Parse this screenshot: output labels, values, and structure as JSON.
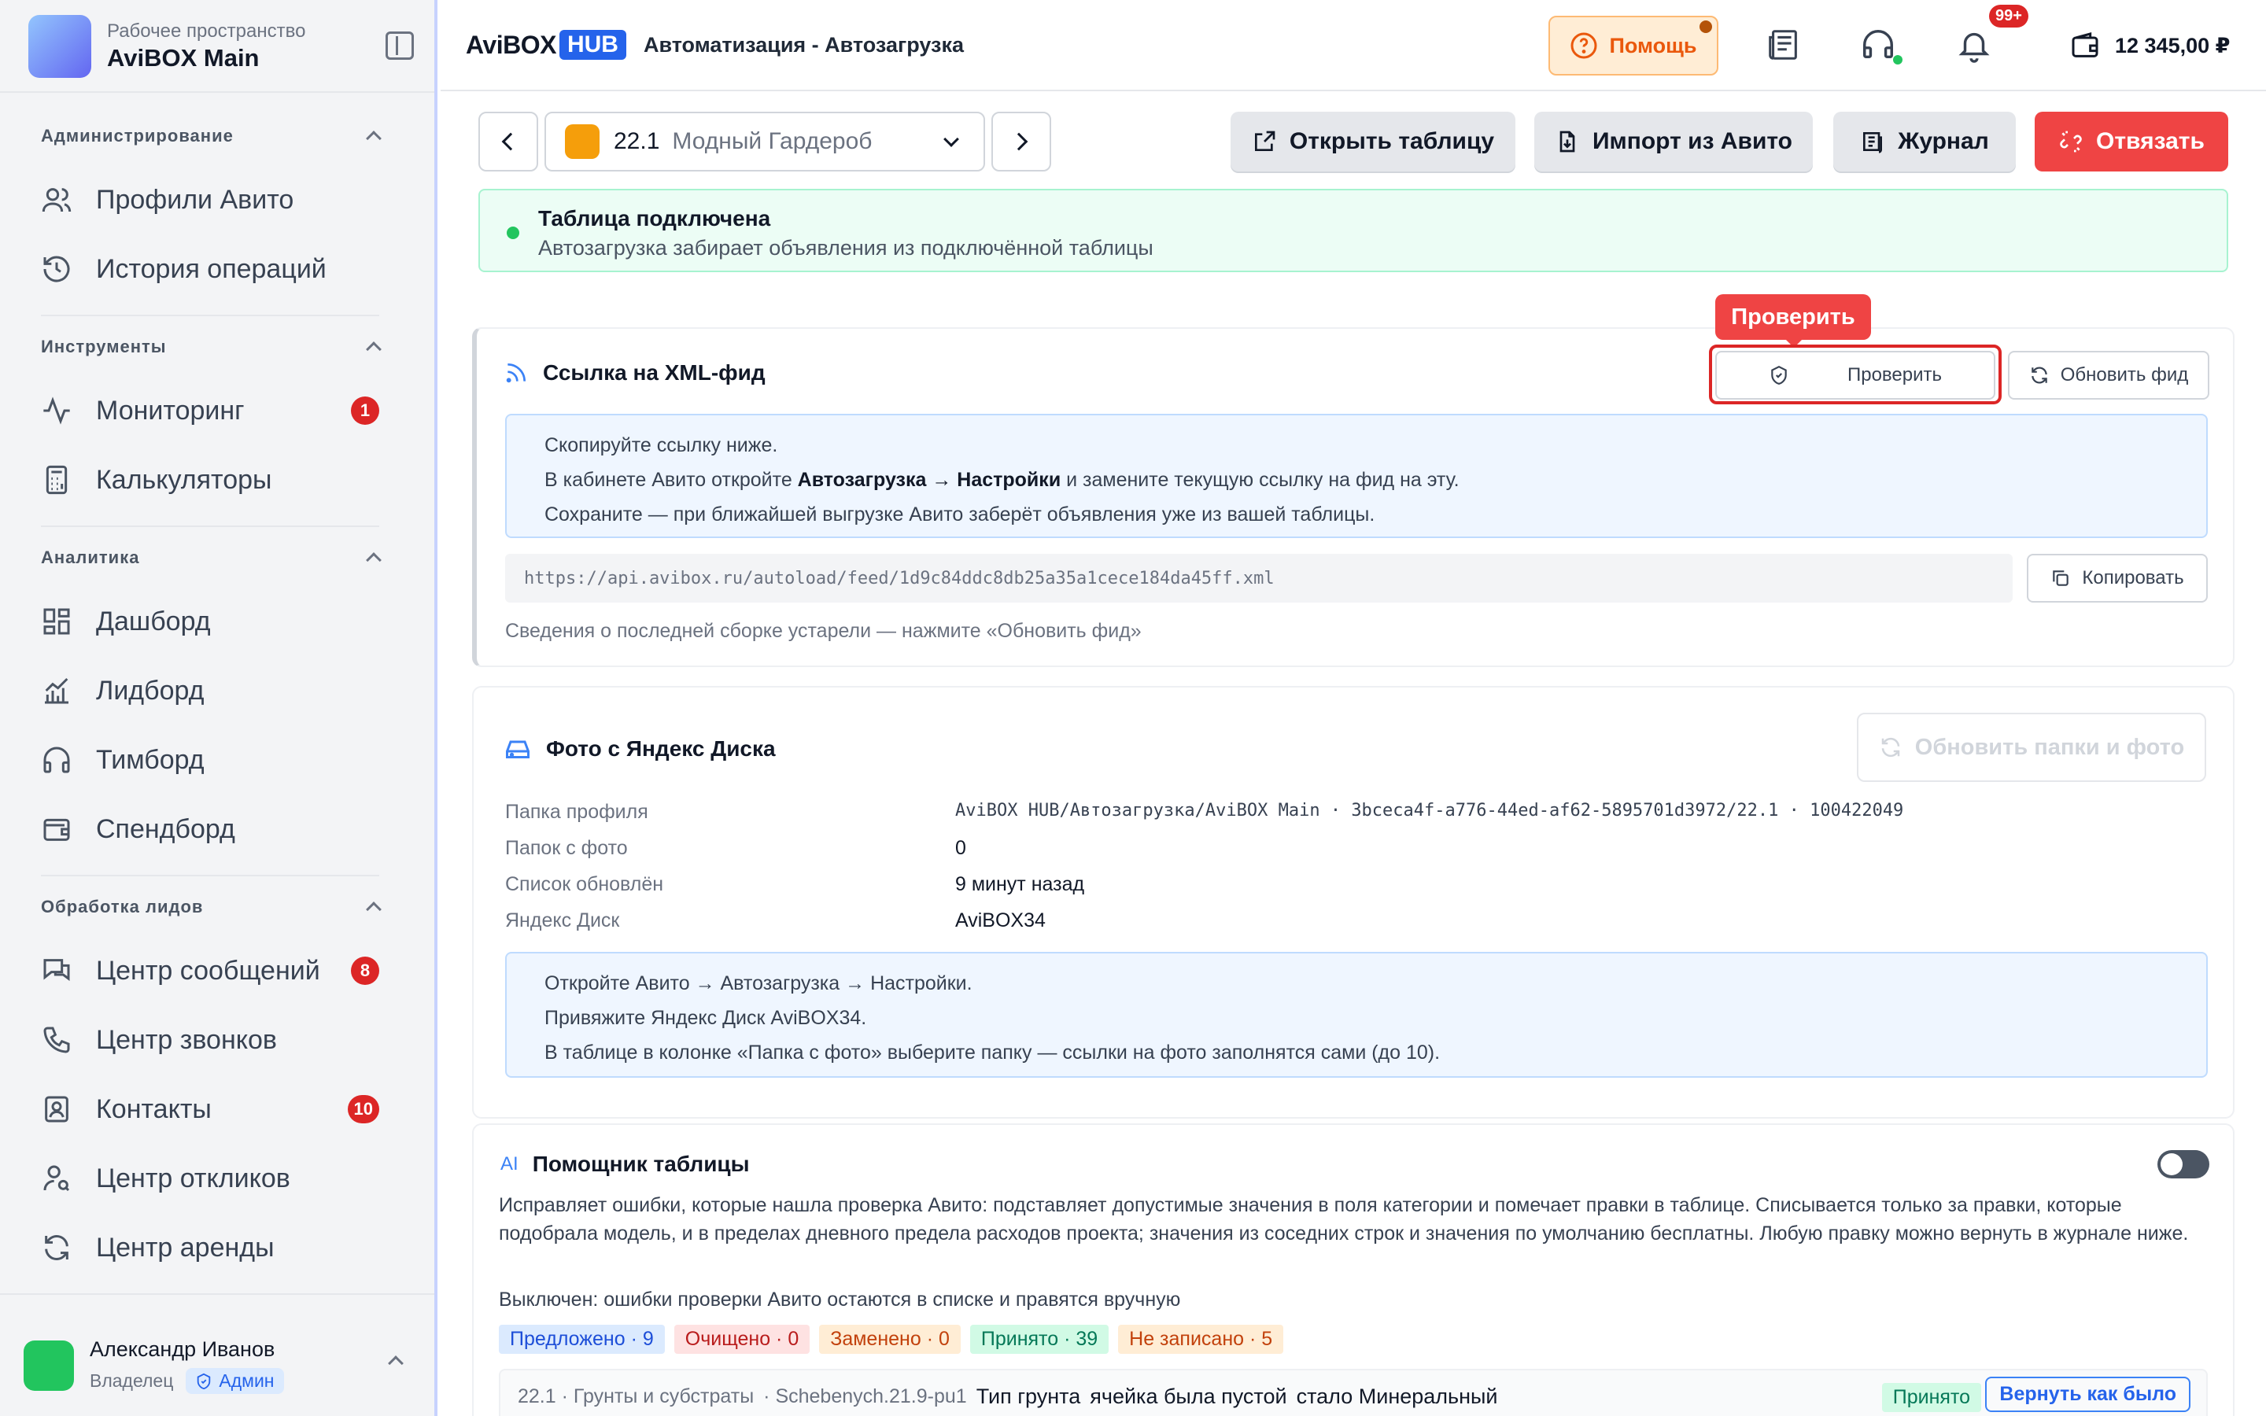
{
  "workspace": {
    "subtitle": "Рабочее пространство",
    "name": "AviBOX Main"
  },
  "sidebar": {
    "sections": [
      {
        "title": "Администрирование",
        "items": [
          {
            "label": "Профили Авито",
            "icon": "users-icon"
          },
          {
            "label": "История операций",
            "icon": "history-icon"
          }
        ]
      },
      {
        "title": "Инструменты",
        "items": [
          {
            "label": "Мониторинг",
            "icon": "activity-icon",
            "badge": "1"
          },
          {
            "label": "Калькуляторы",
            "icon": "calculator-icon"
          }
        ]
      },
      {
        "title": "Аналитика",
        "items": [
          {
            "label": "Дашборд",
            "icon": "dashboard-icon"
          },
          {
            "label": "Лидборд",
            "icon": "chart-icon"
          },
          {
            "label": "Тимборд",
            "icon": "headphones-icon"
          },
          {
            "label": "Спендборд",
            "icon": "wallet-icon"
          }
        ]
      },
      {
        "title": "Обработка лидов",
        "items": [
          {
            "label": "Центр сообщений",
            "icon": "messages-icon",
            "badge": "8"
          },
          {
            "label": "Центр звонков",
            "icon": "phone-icon"
          },
          {
            "label": "Контакты",
            "icon": "contacts-icon",
            "badge": "10"
          },
          {
            "label": "Центр откликов",
            "icon": "user-search-icon"
          },
          {
            "label": "Центр аренды",
            "icon": "refresh-icon"
          }
        ]
      }
    ]
  },
  "user": {
    "name": "Александр Иванов",
    "role": "Владелец",
    "badge": "Админ"
  },
  "header": {
    "brand": "AviBOX",
    "brand_hub": "HUB",
    "title": "Автоматизация - Автозагрузка",
    "help": "Помощь",
    "notifications": "99+",
    "balance": "12 345,00 ₽"
  },
  "toolbar": {
    "table_number": "22.1",
    "table_name": "Модный Гардероб",
    "open_table": "Открыть таблицу",
    "import": "Импорт из Авито",
    "journal": "Журнал",
    "unlink": "Отвязать"
  },
  "banner": {
    "title": "Таблица подключена",
    "subtitle": "Автозагрузка забирает объявления из подключённой таблицы"
  },
  "feed": {
    "title": "Ссылка на XML-фид",
    "tooltip": "Проверить",
    "check": "Проверить",
    "refresh": "Обновить фид",
    "line1": "Скопируйте ссылку ниже.",
    "line2_pre": "В кабинете Авито откройте ",
    "line2_bold1": "Автозагрузка → Настройки",
    "line2_post": " и замените текущую ссылку на фид на эту.",
    "line3": "Сохраните — при ближайшей выгрузке Авито заберёт объявления уже из вашей таблицы.",
    "url": "https://api.avibox.ru/autoload/feed/1d9c84ddc8db25a35a1cece184da45ff.xml",
    "copy": "Копировать",
    "note": "Сведения о последней сборке устарели — нажмите «Обновить фид»"
  },
  "photos": {
    "title": "Фото с Яндекс Диска",
    "refresh": "Обновить папки и фото",
    "rows": [
      {
        "label": "Папка профиля",
        "value": "AviBOX HUB/Автозагрузка/AviBOX Main · 3bceca4f-a776-44ed-af62-5895701d3972/22.1 · 100422049"
      },
      {
        "label": "Папок с фото",
        "value": "0"
      },
      {
        "label": "Список обновлён",
        "value": "9 минут назад"
      },
      {
        "label": "Яндекс Диск",
        "value": "AviBOX34"
      }
    ],
    "line1": "Откройте Авито → Автозагрузка → Настройки.",
    "line2": "Привяжите Яндекс Диск AviBOX34.",
    "line3": "В таблице в колонке «Папка с фото» выберите папку — ссылки на фото заполнятся сами (до 10)."
  },
  "ai": {
    "tag": "AI",
    "title": "Помощник таблицы",
    "description": "Исправляет ошибки, которые нашла проверка Авито: подставляет допустимые значения в поля категории и помечает правки в таблице. Списывается только за правки, которые подобрала модель, и в пределах дневного предела расходов проекта; значения из соседних строк и значения по умолчанию бесплатны. Любую правку можно вернуть в журнале ниже.",
    "status": "Выключен: ошибки проверки Авито остаются в списке и правятся вручную",
    "pills": [
      {
        "label": "Предложено · 9",
        "bg": "#dbeafe",
        "fg": "#1d4ed8"
      },
      {
        "label": "Очищено · 0",
        "bg": "#fee2e2",
        "fg": "#b91c1c"
      },
      {
        "label": "Заменено · 0",
        "bg": "#ffedd5",
        "fg": "#c2410c"
      },
      {
        "label": "Принято · 39",
        "bg": "#d1fae5",
        "fg": "#047857"
      },
      {
        "label": "Не записано · 5",
        "bg": "#ffedd5",
        "fg": "#c2410c"
      }
    ],
    "row": {
      "category": "22.1 · Грунты и субстраты",
      "sku": "· Schebenych.21.9-pu1",
      "field": "Тип грунта",
      "was": "ячейка была пустой",
      "now": "стало Минеральный",
      "status": "Принято",
      "revert": "Вернуть как было"
    }
  }
}
